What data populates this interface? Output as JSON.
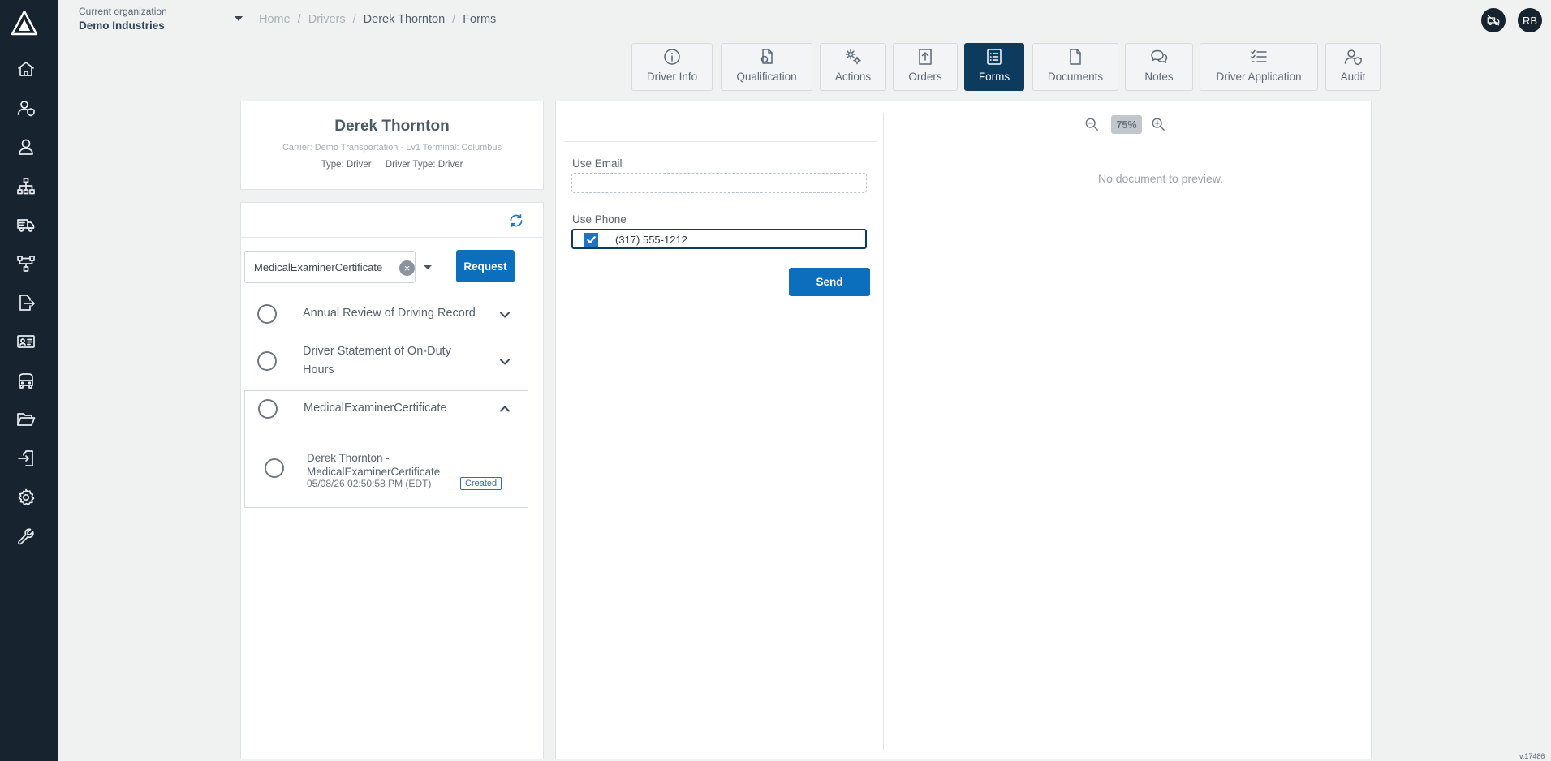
{
  "header": {
    "org_label": "Current organization",
    "org_name": "Demo Industries",
    "breadcrumb": [
      "Home",
      "Drivers",
      "Derek Thornton",
      "Forms"
    ],
    "user_initials": "RB"
  },
  "sidebar": {
    "items": [
      "home-icon",
      "user-shield-icon",
      "user-icon",
      "org-chart-icon",
      "truck-icon",
      "workflow-icon",
      "export-icon",
      "id-card-icon",
      "vehicle-icon",
      "folder-open-icon",
      "login-icon",
      "settings-gear-icon",
      "wrench-icon"
    ]
  },
  "tabs": [
    {
      "label": "Driver Info",
      "icon": "info-icon"
    },
    {
      "label": "Qualification",
      "icon": "qualification-icon"
    },
    {
      "label": "Actions",
      "icon": "gears-icon"
    },
    {
      "label": "Orders",
      "icon": "upload-icon"
    },
    {
      "label": "Forms",
      "icon": "forms-icon",
      "active": true
    },
    {
      "label": "Documents",
      "icon": "document-icon"
    },
    {
      "label": "Notes",
      "icon": "chat-icon"
    },
    {
      "label": "Driver Application",
      "icon": "checklist-icon"
    },
    {
      "label": "Audit",
      "icon": "audit-icon"
    }
  ],
  "profile": {
    "name": "Derek Thornton",
    "carrier": "Carrier: Demo Transportation - Lv1 Terminal: Columbus",
    "type": "Type: Driver",
    "driver_type": "Driver Type: Driver"
  },
  "forms": {
    "selected_form": "MedicalExaminerCertificate",
    "request_label": "Request",
    "items": [
      {
        "label": "Annual Review of Driving Record"
      },
      {
        "label": "Driver Statement of On-Duty Hours"
      },
      {
        "label": "MedicalExaminerCertificate"
      }
    ],
    "instance": {
      "title": "Derek Thornton - MedicalExaminerCertificate",
      "date": "05/08/26 02:50:58 PM (EDT)",
      "status": "Created"
    }
  },
  "send_panel": {
    "use_email_label": "Use Email",
    "use_email_checked": false,
    "use_phone_label": "Use Phone",
    "use_phone_checked": true,
    "phone_value": "(317) 555-1212",
    "send_label": "Send"
  },
  "preview": {
    "zoom": "75%",
    "empty_text": "No document to preview."
  },
  "version": "v.17486",
  "colors": {
    "sidebar": "#17232f",
    "accent": "#0b6fbd",
    "active_tab": "#0d3b5e"
  }
}
